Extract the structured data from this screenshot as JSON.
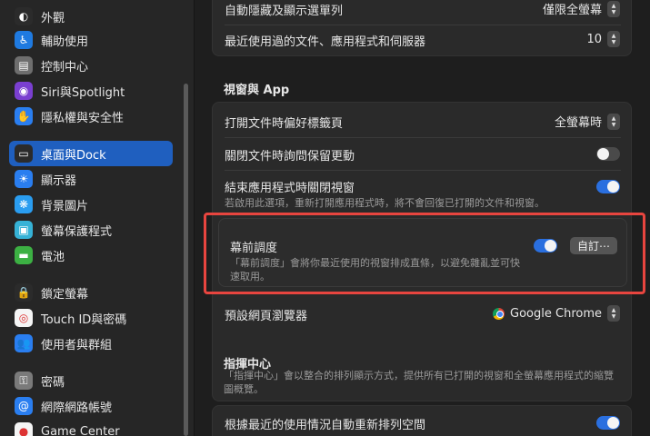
{
  "sidebar": {
    "items": [
      {
        "label": "外觀",
        "icon": "appearance-icon",
        "color": "#2b2b2b",
        "glyph": "◐"
      },
      {
        "label": "輔助使用",
        "icon": "accessibility-icon",
        "color": "#1f7ae0",
        "glyph": "♿"
      },
      {
        "label": "控制中心",
        "icon": "control-center-icon",
        "color": "#6e6e6e",
        "glyph": "▤"
      },
      {
        "label": "Siri與Spotlight",
        "icon": "siri-icon",
        "color": "#7a3fd0",
        "glyph": "◉"
      },
      {
        "label": "隱私權與安全性",
        "icon": "privacy-hand-icon",
        "color": "#2a7ef0",
        "glyph": "✋"
      },
      {
        "label": "桌面與Dock",
        "icon": "desktop-dock-icon",
        "color": "#2b2b2b",
        "glyph": "▭"
      },
      {
        "label": "顯示器",
        "icon": "displays-icon",
        "color": "#2a7ef0",
        "glyph": "☀"
      },
      {
        "label": "背景圖片",
        "icon": "wallpaper-icon",
        "color": "#2a9df0",
        "glyph": "❋"
      },
      {
        "label": "螢幕保護程式",
        "icon": "screensaver-icon",
        "color": "#36b2d6",
        "glyph": "▣"
      },
      {
        "label": "電池",
        "icon": "battery-icon",
        "color": "#3cb043",
        "glyph": "▬"
      },
      {
        "label": "鎖定螢幕",
        "icon": "lock-screen-icon",
        "color": "#2b2b2b",
        "glyph": "🔒"
      },
      {
        "label": "Touch ID與密碼",
        "icon": "touch-id-icon",
        "color": "#f5f5f5",
        "glyph": "◎"
      },
      {
        "label": "使用者與群組",
        "icon": "users-groups-icon",
        "color": "#2a7ef0",
        "glyph": "👥"
      },
      {
        "label": "密碼",
        "icon": "passwords-key-icon",
        "color": "#7a7a7a",
        "glyph": "⚿"
      },
      {
        "label": "網際網路帳號",
        "icon": "internet-accounts-icon",
        "color": "#2a7ef0",
        "glyph": "@"
      },
      {
        "label": "Game Center",
        "icon": "game-center-icon",
        "color": "#f5f5f5",
        "glyph": "●"
      }
    ],
    "active_index": 5
  },
  "main": {
    "top_rows": [
      {
        "label": "自動隱藏及顯示選單列",
        "value": "僅限全螢幕"
      },
      {
        "label": "最近使用過的文件、應用程式和伺服器",
        "value": "10"
      }
    ],
    "windows_section": {
      "title": "視窗與 App",
      "open_tabs_label": "打開文件時偏好標籤頁",
      "open_tabs_value": "全螢幕時",
      "ask_keep_changes_label": "關閉文件時詢問保留更動",
      "ask_keep_changes_on": false,
      "close_windows_label": "結束應用程式時關閉視窗",
      "close_windows_sub": "若啟用此選項，重新打開應用程式時，將不會回復已打開的文件和視窗。",
      "close_windows_on": true,
      "stage_manager_label": "幕前調度",
      "stage_manager_sub_1": "「幕前調度」會將你最近使用的視窗排成直條，以避免雜亂並可快",
      "stage_manager_sub_2": "速取用。",
      "stage_manager_on": true,
      "customize_button": "自訂⋯",
      "browser_label": "預設網頁瀏覽器",
      "browser_value": "Google Chrome"
    },
    "mission_control": {
      "title": "指揮中心",
      "sub_1": "「指揮中心」會以整合的排列顯示方式，提供所有已打開的視窗和全螢幕應用程式的縮覽",
      "sub_2": "圖概覽。",
      "rearrange_label": "根據最近的使用情況自動重新排列空間",
      "rearrange_on": true
    }
  },
  "colors": {
    "highlight": "#e8453f",
    "accent": "#2a6fdf"
  }
}
